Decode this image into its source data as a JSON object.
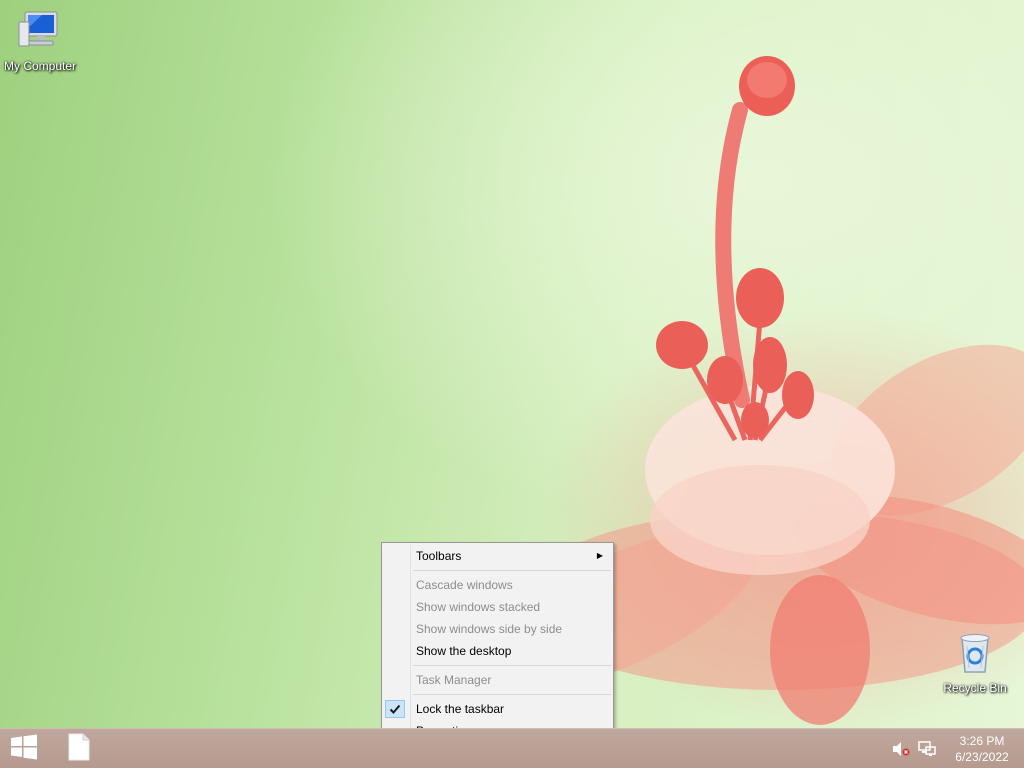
{
  "desktop": {
    "icons": [
      {
        "label": "My Computer"
      },
      {
        "label": "Recycle Bin"
      }
    ]
  },
  "context_menu": {
    "items": [
      {
        "label": "Toolbars",
        "enabled": true,
        "submenu": true
      },
      {
        "label": "Cascade windows",
        "enabled": false
      },
      {
        "label": "Show windows stacked",
        "enabled": false
      },
      {
        "label": "Show windows side by side",
        "enabled": false
      },
      {
        "label": "Show the desktop",
        "enabled": true
      },
      {
        "label": "Task Manager",
        "enabled": false
      },
      {
        "label": "Lock the taskbar",
        "enabled": true,
        "checked": true
      },
      {
        "label": "Properties",
        "enabled": true
      }
    ]
  },
  "taskbar": {
    "start_icon": "windows-logo-icon",
    "pinned": [
      {
        "icon": "blank-file-icon"
      }
    ],
    "tray_icons": [
      "speaker-muted-icon",
      "network-icon"
    ],
    "clock": {
      "time": "3:26 PM",
      "date": "6/23/2022"
    }
  },
  "colors": {
    "taskbar": "#b9a094",
    "menu_background": "#f2f2f2",
    "menu_disabled_text": "#8d8d8d",
    "check_highlight": "#cde4f7"
  }
}
